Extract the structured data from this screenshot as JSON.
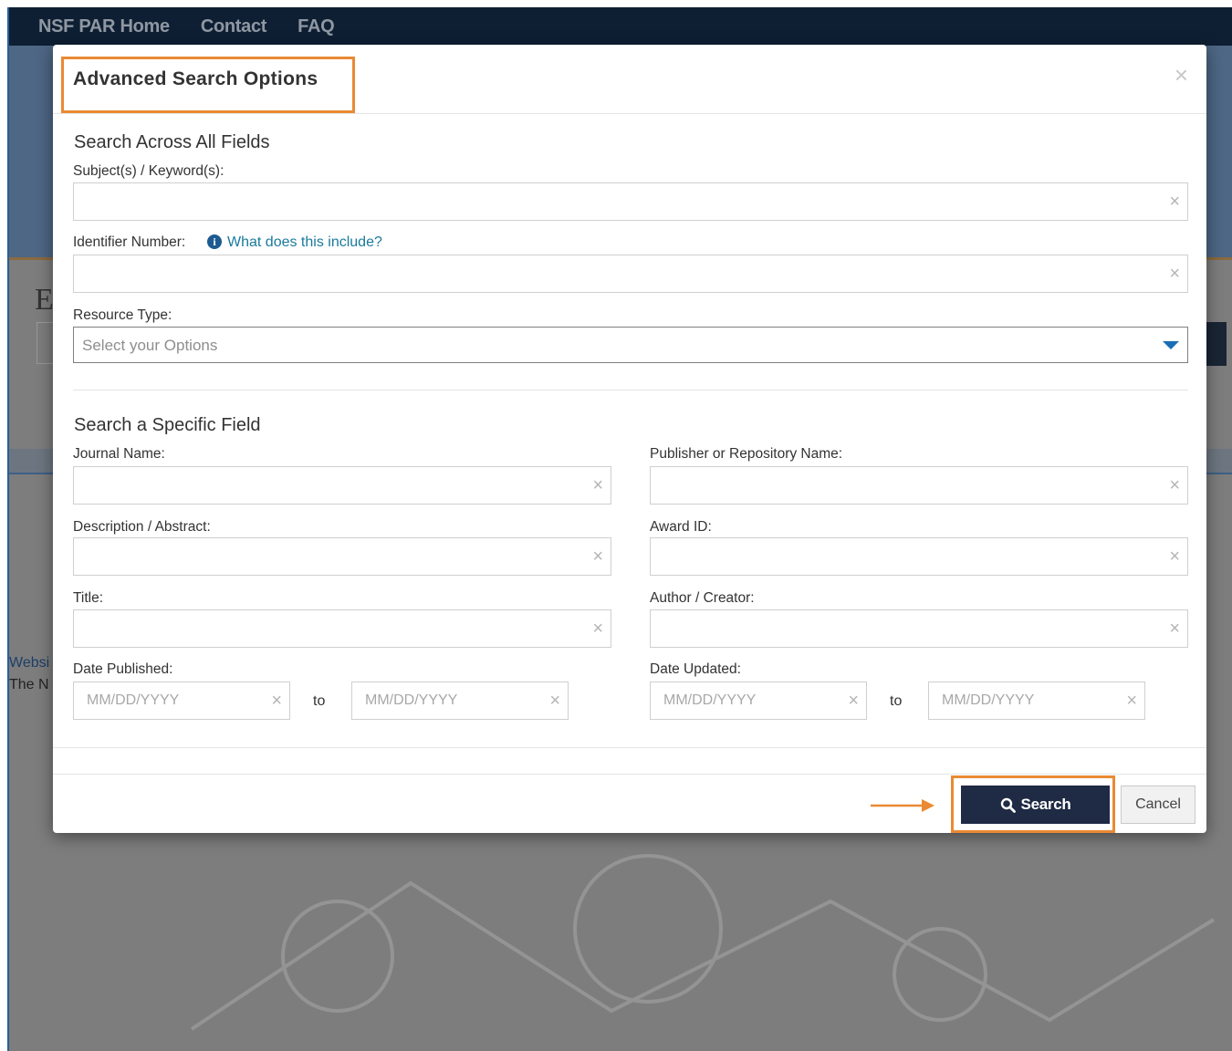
{
  "nav": {
    "items": [
      "NSF PAR Home",
      "Contact",
      "FAQ"
    ]
  },
  "background": {
    "footer_link": "Websi",
    "footer_text": "The N"
  },
  "modal": {
    "title": "Advanced Search Options",
    "close": "×",
    "section1": {
      "title": "Search Across All Fields",
      "subjects_label": "Subject(s) / Keyword(s):",
      "identifier_label": "Identifier Number:",
      "identifier_help": "What does this include?",
      "resource_type_label": "Resource Type:",
      "resource_type_placeholder": "Select your Options"
    },
    "section2": {
      "title": "Search a Specific Field",
      "journal_label": "Journal Name:",
      "publisher_label": "Publisher or Repository Name:",
      "description_label": "Description / Abstract:",
      "award_label": "Award ID:",
      "title_label": "Title:",
      "author_label": "Author / Creator:",
      "date_published_label": "Date Published:",
      "date_updated_label": "Date Updated:",
      "date_placeholder": "MM/DD/YYYY",
      "to": "to"
    },
    "buttons": {
      "search": "Search",
      "cancel": "Cancel"
    }
  },
  "colors": {
    "highlight": "#ea8a33",
    "primary_button": "#1f2a44",
    "nav": "#0e1f33",
    "link": "#1a7a9c"
  }
}
